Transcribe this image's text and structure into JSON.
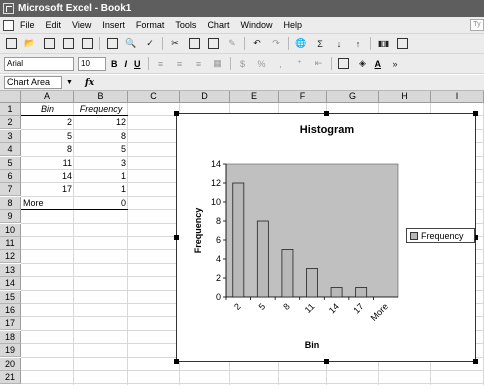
{
  "window": {
    "title": "Microsoft Excel - Book1"
  },
  "menu": {
    "items": [
      "File",
      "Edit",
      "View",
      "Insert",
      "Format",
      "Tools",
      "Chart",
      "Window",
      "Help"
    ],
    "ask_box": "Ty"
  },
  "format_toolbar": {
    "font": "Arial",
    "size": "10",
    "bold": "B",
    "italic": "I",
    "underline": "U",
    "percent": "%",
    "comma": ",",
    "font_color": "A"
  },
  "name_box": {
    "value": "Chart Area"
  },
  "formula_bar": {
    "fx": "fx"
  },
  "sheet": {
    "columns": [
      "A",
      "B",
      "C",
      "D",
      "E",
      "F",
      "G",
      "H",
      "I"
    ],
    "rows": [
      "1",
      "2",
      "3",
      "4",
      "5",
      "6",
      "7",
      "8",
      "9",
      "10",
      "11",
      "12",
      "13",
      "14",
      "15",
      "16",
      "17",
      "18",
      "19",
      "20",
      "21"
    ],
    "header_bin": "Bin",
    "header_frequency": "Frequency",
    "table": [
      {
        "bin": "2",
        "freq": "12"
      },
      {
        "bin": "5",
        "freq": "8"
      },
      {
        "bin": "8",
        "freq": "5"
      },
      {
        "bin": "11",
        "freq": "3"
      },
      {
        "bin": "14",
        "freq": "1"
      },
      {
        "bin": "17",
        "freq": "1"
      },
      {
        "bin": "More",
        "freq": "0"
      }
    ]
  },
  "chart_data": {
    "type": "bar",
    "title": "Histogram",
    "xlabel": "Bin",
    "ylabel": "Frequency",
    "categories": [
      "2",
      "5",
      "8",
      "11",
      "14",
      "17",
      "More"
    ],
    "series": [
      {
        "name": "Frequency",
        "values": [
          12,
          8,
          5,
          3,
          1,
          1,
          0
        ]
      }
    ],
    "ylim": [
      0,
      14
    ],
    "yticks": [
      "0",
      "2",
      "4",
      "6",
      "8",
      "10",
      "12",
      "14"
    ],
    "legend": "right",
    "bar_color": "#b8b8b8",
    "plot_background": "#c0c0c0"
  }
}
